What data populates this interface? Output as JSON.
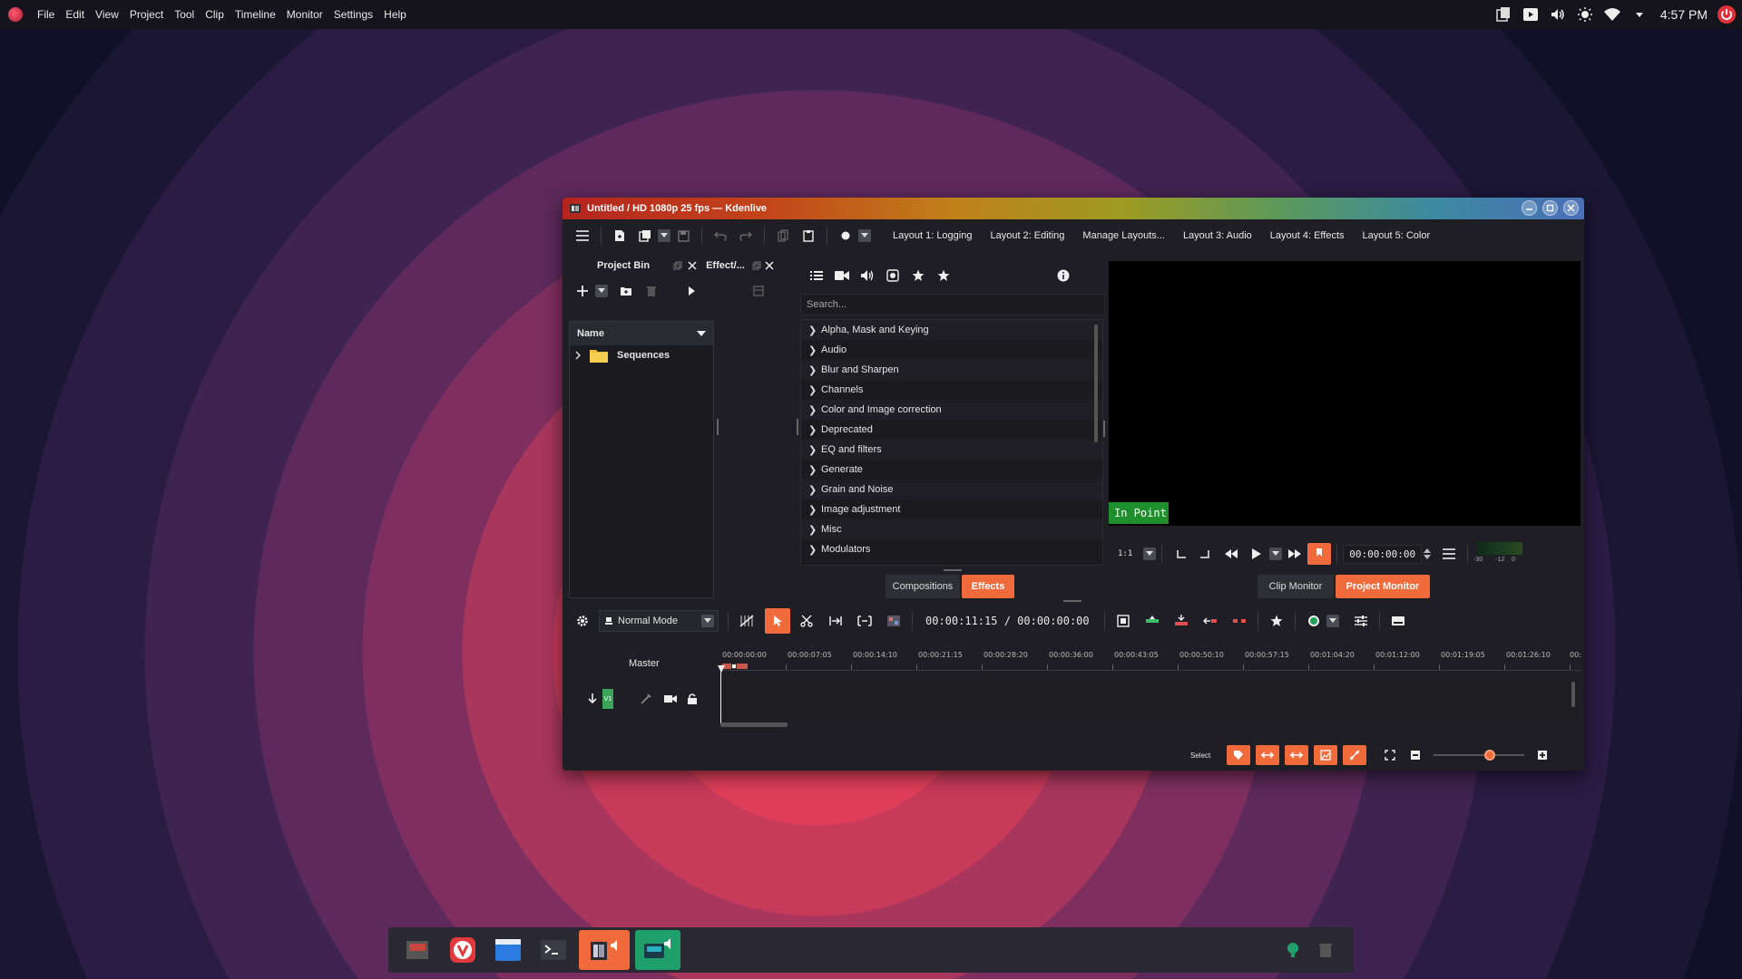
{
  "topbar": {
    "menu": [
      "File",
      "Edit",
      "View",
      "Project",
      "Tool",
      "Clip",
      "Timeline",
      "Monitor",
      "Settings",
      "Help"
    ],
    "clock": "4:57 PM"
  },
  "window": {
    "title": "Untitled / HD 1080p 25 fps — Kdenlive",
    "layouts": [
      "Layout 1: Logging",
      "Layout 2: Editing",
      "Manage Layouts...",
      "Layout 3: Audio",
      "Layout 4: Effects",
      "Layout 5: Color"
    ]
  },
  "project_bin": {
    "tab_label": "Project Bin",
    "effects_tab_label": "Effect/...",
    "column_header": "Name",
    "items": [
      "Sequences"
    ]
  },
  "effects": {
    "search_placeholder": "Search...",
    "categories": [
      "Alpha, Mask and Keying",
      "Audio",
      "Blur and Sharpen",
      "Channels",
      "Color and Image correction",
      "Deprecated",
      "EQ and filters",
      "Generate",
      "Grain and Noise",
      "Image adjustment",
      "Misc",
      "Modulators"
    ],
    "tabs": {
      "compositions": "Compositions",
      "effects": "Effects"
    }
  },
  "monitor": {
    "in_point_label": "In Point",
    "zoom": "1:1",
    "timecode": "00:00:00:00",
    "tabs": {
      "clip": "Clip Monitor",
      "project": "Project Monitor"
    },
    "meter_labels": [
      "-30",
      "-12",
      "0"
    ]
  },
  "timeline": {
    "mode": "Normal Mode",
    "position": "00:00:11:15 / 00:00:00:00",
    "master_label": "Master",
    "track_name": "V1",
    "select_label": "Select",
    "ruler_ticks": [
      "00:00:00:00",
      "00:00:07:05",
      "00:00:14:10",
      "00:00:21:15",
      "00:00:28:20",
      "00:00:36:00",
      "00:00:43:05",
      "00:00:50:10",
      "00:00:57:15",
      "00:01:04:20",
      "00:01:12:00",
      "00:01:19:05",
      "00:01:26:10",
      "00:"
    ]
  },
  "colors": {
    "accent": "#f06a3c",
    "in_point": "#1f8f2d",
    "panel": "#1e1e24"
  }
}
